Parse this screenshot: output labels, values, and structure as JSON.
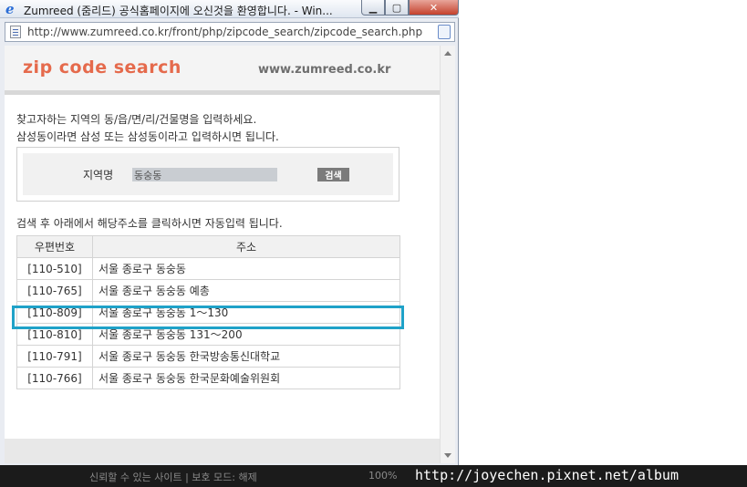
{
  "window": {
    "title": "Zumreed (줌리드) 공식홈페이지에 오신것을 환영합니다. - Win...",
    "url": "http://www.zumreed.co.kr/front/php/zipcode_search/zipcode_search.php"
  },
  "banner": {
    "logo": "zip code  search",
    "site_url": "www.zumreed.co.kr"
  },
  "instructions": {
    "line1": "찾고자하는 지역의 동/읍/면/리/건물명을 입력하세요.",
    "line2": "삼성동이라면 삼성 또는 삼성동이라고 입력하시면 됩니다.",
    "line3": "검색 후 아래에서 해당주소를 클릭하시면 자동입력 됩니다."
  },
  "search": {
    "label": "지역명",
    "value": "동숭동",
    "button": "검색"
  },
  "table": {
    "headers": [
      "우편번호",
      "주소"
    ],
    "rows": [
      {
        "zip": "[110-510]",
        "address": "서울 종로구 동숭동"
      },
      {
        "zip": "[110-765]",
        "address": "서울 종로구 동숭동 예총"
      },
      {
        "zip": "[110-809]",
        "address": "서울 종로구 동숭동 1～130"
      },
      {
        "zip": "[110-810]",
        "address": "서울 종로구 동숭동 131～200"
      },
      {
        "zip": "[110-791]",
        "address": "서울 종로구 동숭동 한국방송통신대학교"
      },
      {
        "zip": "[110-766]",
        "address": "서울 종로구 동숭동 한국문화예술위원회"
      }
    ]
  },
  "statusbar": {
    "left": "신뢰할 수 있는 사이트 | 보호 모드: 해제",
    "zoom": "100%",
    "watermark": "http://joyechen.pixnet.net/album"
  },
  "colors": {
    "logo": "#e56a4c",
    "highlight": "#1fa2c8"
  }
}
